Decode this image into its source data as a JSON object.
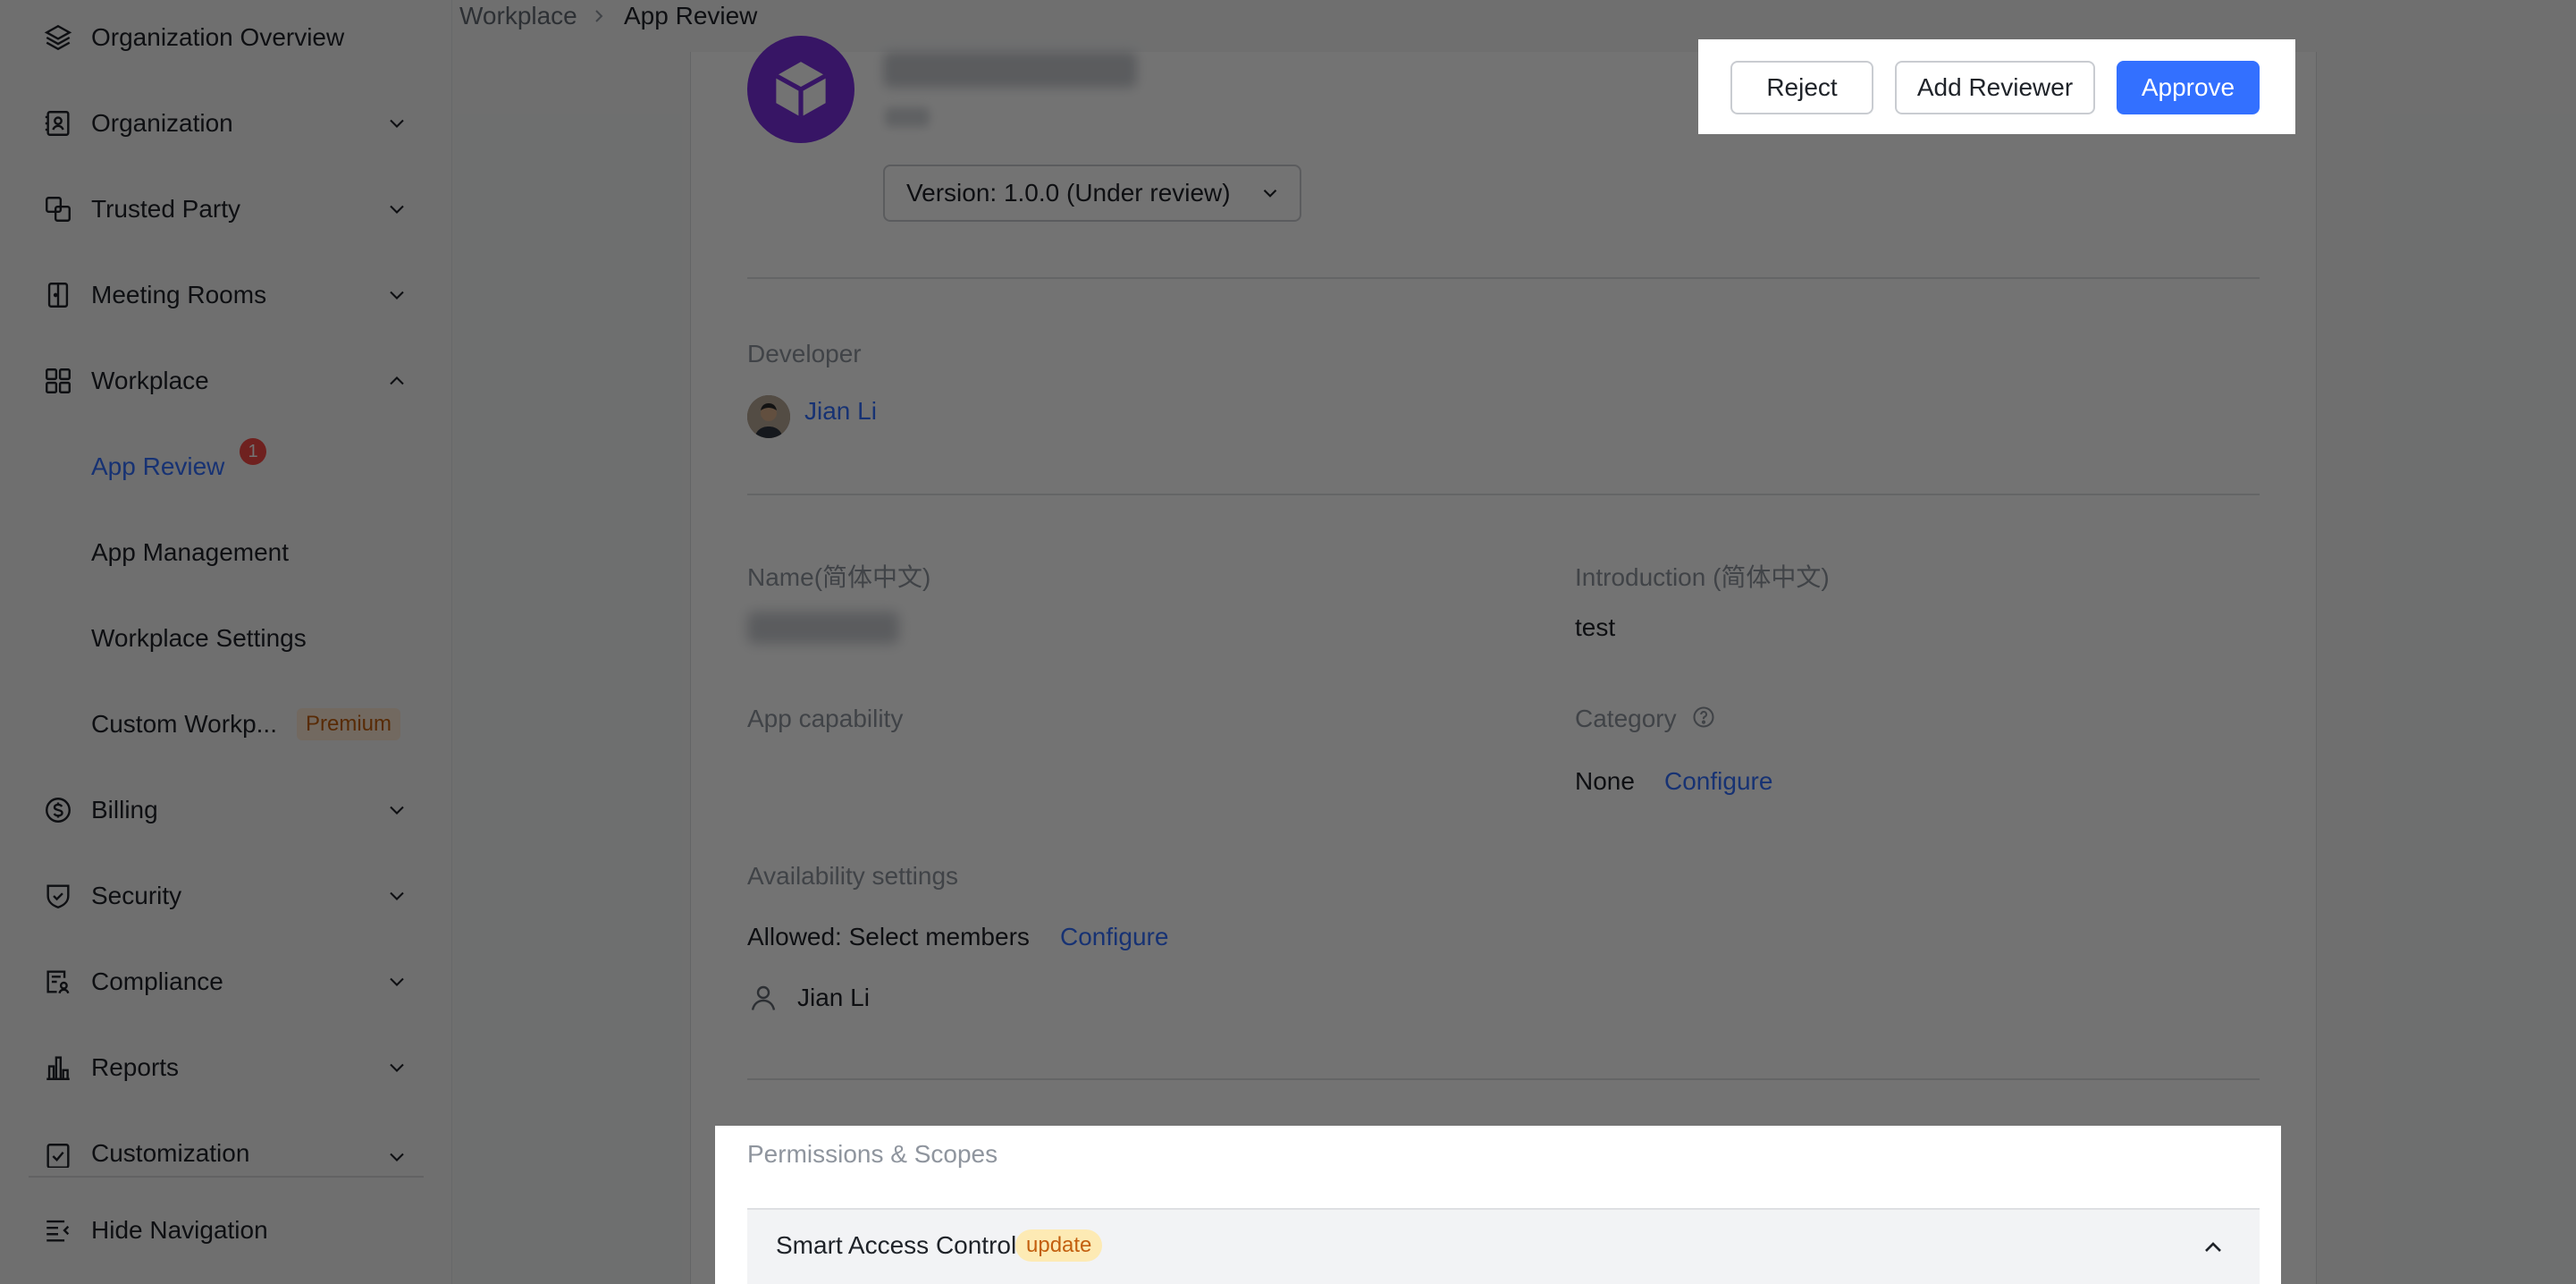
{
  "breadcrumb": {
    "parent": "Workplace",
    "current": "App Review"
  },
  "sidebar": {
    "items": [
      {
        "label": "Organization Overview",
        "icon": "layers-icon"
      },
      {
        "label": "Organization",
        "icon": "org-icon"
      },
      {
        "label": "Trusted Party",
        "icon": "trusted-party-icon"
      },
      {
        "label": "Meeting Rooms",
        "icon": "meeting-room-icon"
      },
      {
        "label": "Workplace",
        "icon": "grid-icon"
      },
      {
        "label": "App Review",
        "badge": "1"
      },
      {
        "label": "App Management"
      },
      {
        "label": "Workplace Settings"
      },
      {
        "label": "Custom Workp...",
        "tag": "Premium"
      },
      {
        "label": "Billing",
        "icon": "dollar-icon"
      },
      {
        "label": "Security",
        "icon": "shield-icon"
      },
      {
        "label": "Compliance",
        "icon": "compliance-icon"
      },
      {
        "label": "Reports",
        "icon": "chart-icon"
      },
      {
        "label": "Customization",
        "icon": "customization-icon"
      }
    ],
    "hide_nav": "Hide Navigation"
  },
  "app": {
    "version_select": "Version: 1.0.0 (Under review)"
  },
  "actions": {
    "reject": "Reject",
    "add_reviewer": "Add Reviewer",
    "approve": "Approve"
  },
  "developer": {
    "label": "Developer",
    "name": "Jian Li"
  },
  "fields": {
    "name_label": "Name(简体中文)",
    "intro_label": "Introduction (简体中文)",
    "intro_value": "test",
    "capability_label": "App capability",
    "category_label": "Category",
    "category_value": "None",
    "category_configure": "Configure",
    "availability_label": "Availability settings",
    "allowed_value": "Allowed: Select members",
    "allowed_configure": "Configure",
    "member": "Jian Li"
  },
  "permissions": {
    "title": "Permissions & Scopes",
    "item_name": "Smart Access Control",
    "item_tag": "update"
  },
  "colors": {
    "accent": "#3370ff",
    "app_logo": "#7b2fe0",
    "badge": "#f54a45"
  }
}
